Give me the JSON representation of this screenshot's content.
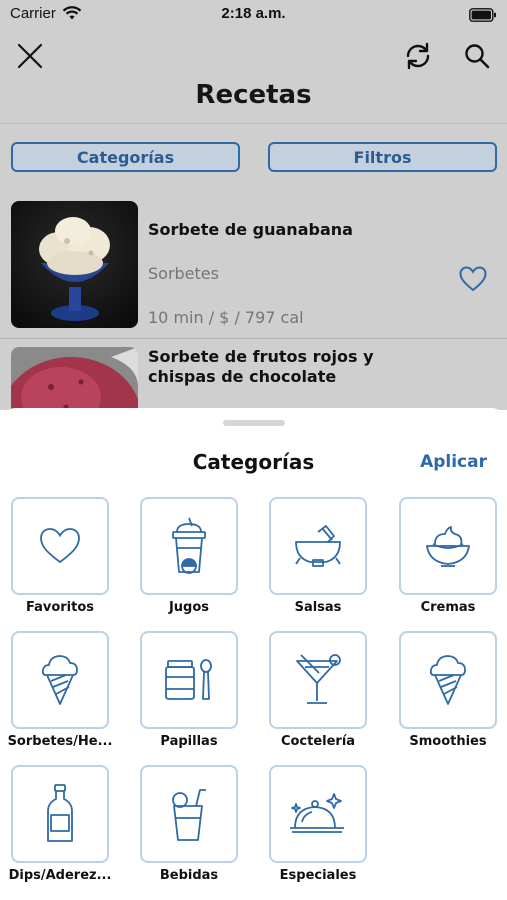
{
  "status": {
    "carrier": "Carrier",
    "time": "2:18 a.m."
  },
  "header": {
    "title": "Recetas"
  },
  "filters": {
    "categories_label": "Categorías",
    "filters_label": "Filtros"
  },
  "recipes": [
    {
      "name": "Sorbete de guanabana",
      "category": "Sorbetes",
      "meta": "10 min / $ / 797 cal"
    },
    {
      "name": "Sorbete de frutos rojos y chispas de chocolate"
    }
  ],
  "sheet": {
    "title": "Categorías",
    "apply_label": "Aplicar",
    "categories": [
      {
        "label": "Favoritos",
        "icon": "heart-icon"
      },
      {
        "label": "Jugos",
        "icon": "juice-cup-icon"
      },
      {
        "label": "Salsas",
        "icon": "mortar-icon"
      },
      {
        "label": "Cremas",
        "icon": "cream-bowl-icon"
      },
      {
        "label": "Sorbetes/He...",
        "icon": "ice-cream-cone-icon"
      },
      {
        "label": "Papillas",
        "icon": "baby-food-jar-icon"
      },
      {
        "label": "Coctelería",
        "icon": "cocktail-icon"
      },
      {
        "label": "Smoothies",
        "icon": "ice-cream-cone-icon"
      },
      {
        "label": "Dips/Aderez...",
        "icon": "bottle-icon"
      },
      {
        "label": "Bebidas",
        "icon": "drink-glass-icon"
      },
      {
        "label": "Especiales",
        "icon": "cloche-icon"
      }
    ]
  },
  "colors": {
    "accent": "#2b6aa8",
    "tile_border": "#b9d2ea",
    "icon": "#2f6aa6",
    "overlay": "#cfcfcf"
  }
}
